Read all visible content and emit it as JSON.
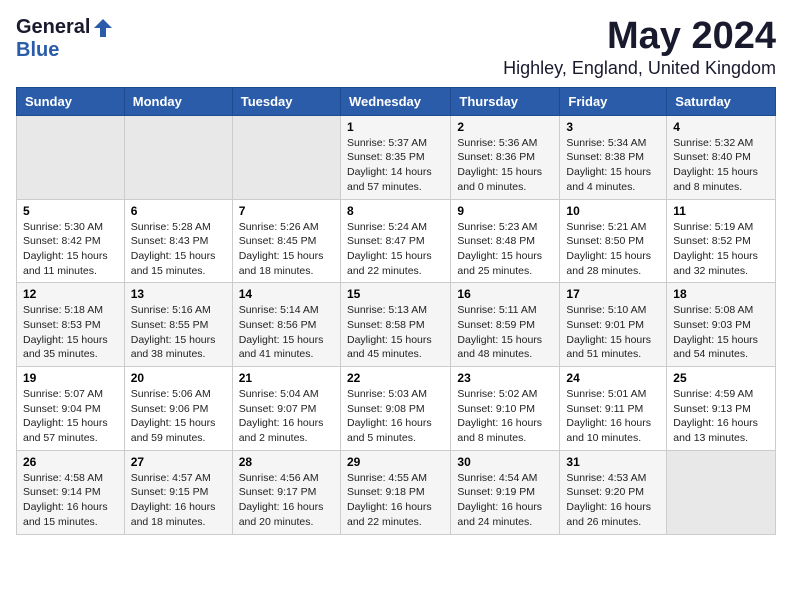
{
  "header": {
    "logo_general": "General",
    "logo_blue": "Blue",
    "month_title": "May 2024",
    "location": "Highley, England, United Kingdom"
  },
  "days_of_week": [
    "Sunday",
    "Monday",
    "Tuesday",
    "Wednesday",
    "Thursday",
    "Friday",
    "Saturday"
  ],
  "weeks": [
    [
      {
        "day": "",
        "info": ""
      },
      {
        "day": "",
        "info": ""
      },
      {
        "day": "",
        "info": ""
      },
      {
        "day": "1",
        "info": "Sunrise: 5:37 AM\nSunset: 8:35 PM\nDaylight: 14 hours\nand 57 minutes."
      },
      {
        "day": "2",
        "info": "Sunrise: 5:36 AM\nSunset: 8:36 PM\nDaylight: 15 hours\nand 0 minutes."
      },
      {
        "day": "3",
        "info": "Sunrise: 5:34 AM\nSunset: 8:38 PM\nDaylight: 15 hours\nand 4 minutes."
      },
      {
        "day": "4",
        "info": "Sunrise: 5:32 AM\nSunset: 8:40 PM\nDaylight: 15 hours\nand 8 minutes."
      }
    ],
    [
      {
        "day": "5",
        "info": "Sunrise: 5:30 AM\nSunset: 8:42 PM\nDaylight: 15 hours\nand 11 minutes."
      },
      {
        "day": "6",
        "info": "Sunrise: 5:28 AM\nSunset: 8:43 PM\nDaylight: 15 hours\nand 15 minutes."
      },
      {
        "day": "7",
        "info": "Sunrise: 5:26 AM\nSunset: 8:45 PM\nDaylight: 15 hours\nand 18 minutes."
      },
      {
        "day": "8",
        "info": "Sunrise: 5:24 AM\nSunset: 8:47 PM\nDaylight: 15 hours\nand 22 minutes."
      },
      {
        "day": "9",
        "info": "Sunrise: 5:23 AM\nSunset: 8:48 PM\nDaylight: 15 hours\nand 25 minutes."
      },
      {
        "day": "10",
        "info": "Sunrise: 5:21 AM\nSunset: 8:50 PM\nDaylight: 15 hours\nand 28 minutes."
      },
      {
        "day": "11",
        "info": "Sunrise: 5:19 AM\nSunset: 8:52 PM\nDaylight: 15 hours\nand 32 minutes."
      }
    ],
    [
      {
        "day": "12",
        "info": "Sunrise: 5:18 AM\nSunset: 8:53 PM\nDaylight: 15 hours\nand 35 minutes."
      },
      {
        "day": "13",
        "info": "Sunrise: 5:16 AM\nSunset: 8:55 PM\nDaylight: 15 hours\nand 38 minutes."
      },
      {
        "day": "14",
        "info": "Sunrise: 5:14 AM\nSunset: 8:56 PM\nDaylight: 15 hours\nand 41 minutes."
      },
      {
        "day": "15",
        "info": "Sunrise: 5:13 AM\nSunset: 8:58 PM\nDaylight: 15 hours\nand 45 minutes."
      },
      {
        "day": "16",
        "info": "Sunrise: 5:11 AM\nSunset: 8:59 PM\nDaylight: 15 hours\nand 48 minutes."
      },
      {
        "day": "17",
        "info": "Sunrise: 5:10 AM\nSunset: 9:01 PM\nDaylight: 15 hours\nand 51 minutes."
      },
      {
        "day": "18",
        "info": "Sunrise: 5:08 AM\nSunset: 9:03 PM\nDaylight: 15 hours\nand 54 minutes."
      }
    ],
    [
      {
        "day": "19",
        "info": "Sunrise: 5:07 AM\nSunset: 9:04 PM\nDaylight: 15 hours\nand 57 minutes."
      },
      {
        "day": "20",
        "info": "Sunrise: 5:06 AM\nSunset: 9:06 PM\nDaylight: 15 hours\nand 59 minutes."
      },
      {
        "day": "21",
        "info": "Sunrise: 5:04 AM\nSunset: 9:07 PM\nDaylight: 16 hours\nand 2 minutes."
      },
      {
        "day": "22",
        "info": "Sunrise: 5:03 AM\nSunset: 9:08 PM\nDaylight: 16 hours\nand 5 minutes."
      },
      {
        "day": "23",
        "info": "Sunrise: 5:02 AM\nSunset: 9:10 PM\nDaylight: 16 hours\nand 8 minutes."
      },
      {
        "day": "24",
        "info": "Sunrise: 5:01 AM\nSunset: 9:11 PM\nDaylight: 16 hours\nand 10 minutes."
      },
      {
        "day": "25",
        "info": "Sunrise: 4:59 AM\nSunset: 9:13 PM\nDaylight: 16 hours\nand 13 minutes."
      }
    ],
    [
      {
        "day": "26",
        "info": "Sunrise: 4:58 AM\nSunset: 9:14 PM\nDaylight: 16 hours\nand 15 minutes."
      },
      {
        "day": "27",
        "info": "Sunrise: 4:57 AM\nSunset: 9:15 PM\nDaylight: 16 hours\nand 18 minutes."
      },
      {
        "day": "28",
        "info": "Sunrise: 4:56 AM\nSunset: 9:17 PM\nDaylight: 16 hours\nand 20 minutes."
      },
      {
        "day": "29",
        "info": "Sunrise: 4:55 AM\nSunset: 9:18 PM\nDaylight: 16 hours\nand 22 minutes."
      },
      {
        "day": "30",
        "info": "Sunrise: 4:54 AM\nSunset: 9:19 PM\nDaylight: 16 hours\nand 24 minutes."
      },
      {
        "day": "31",
        "info": "Sunrise: 4:53 AM\nSunset: 9:20 PM\nDaylight: 16 hours\nand 26 minutes."
      },
      {
        "day": "",
        "info": ""
      }
    ]
  ]
}
